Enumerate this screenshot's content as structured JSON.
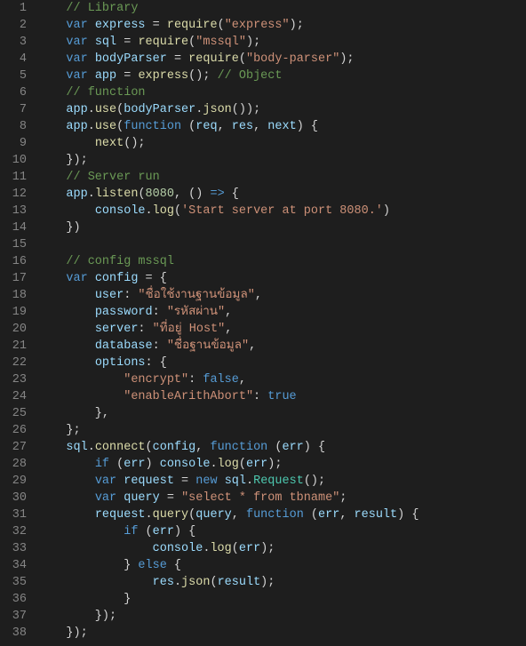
{
  "lines": [
    [
      [
        "c-comment",
        "// Library"
      ]
    ],
    [
      [
        "c-keyword",
        "var"
      ],
      [
        "c-punc",
        " "
      ],
      [
        "c-var",
        "express"
      ],
      [
        "c-punc",
        " = "
      ],
      [
        "c-func",
        "require"
      ],
      [
        "c-punc",
        "("
      ],
      [
        "c-string",
        "\"express\""
      ],
      [
        "c-punc",
        ");"
      ]
    ],
    [
      [
        "c-keyword",
        "var"
      ],
      [
        "c-punc",
        " "
      ],
      [
        "c-var",
        "sql"
      ],
      [
        "c-punc",
        " = "
      ],
      [
        "c-func",
        "require"
      ],
      [
        "c-punc",
        "("
      ],
      [
        "c-string",
        "\"mssql\""
      ],
      [
        "c-punc",
        ");"
      ]
    ],
    [
      [
        "c-keyword",
        "var"
      ],
      [
        "c-punc",
        " "
      ],
      [
        "c-var",
        "bodyParser"
      ],
      [
        "c-punc",
        " = "
      ],
      [
        "c-func",
        "require"
      ],
      [
        "c-punc",
        "("
      ],
      [
        "c-string",
        "\"body-parser\""
      ],
      [
        "c-punc",
        ");"
      ]
    ],
    [
      [
        "c-keyword",
        "var"
      ],
      [
        "c-punc",
        " "
      ],
      [
        "c-var",
        "app"
      ],
      [
        "c-punc",
        " = "
      ],
      [
        "c-func",
        "express"
      ],
      [
        "c-punc",
        "(); "
      ],
      [
        "c-comment",
        "// Object"
      ]
    ],
    [
      [
        "c-comment",
        "// function"
      ]
    ],
    [
      [
        "c-var",
        "app"
      ],
      [
        "c-punc",
        "."
      ],
      [
        "c-func",
        "use"
      ],
      [
        "c-punc",
        "("
      ],
      [
        "c-var",
        "bodyParser"
      ],
      [
        "c-punc",
        "."
      ],
      [
        "c-func",
        "json"
      ],
      [
        "c-punc",
        "());"
      ]
    ],
    [
      [
        "c-var",
        "app"
      ],
      [
        "c-punc",
        "."
      ],
      [
        "c-func",
        "use"
      ],
      [
        "c-punc",
        "("
      ],
      [
        "c-keyword",
        "function"
      ],
      [
        "c-punc",
        " ("
      ],
      [
        "c-param",
        "req"
      ],
      [
        "c-punc",
        ", "
      ],
      [
        "c-param",
        "res"
      ],
      [
        "c-punc",
        ", "
      ],
      [
        "c-param",
        "next"
      ],
      [
        "c-punc",
        ") {"
      ]
    ],
    [
      [
        "c-punc",
        "    "
      ],
      [
        "c-func",
        "next"
      ],
      [
        "c-punc",
        "();"
      ]
    ],
    [
      [
        "c-punc",
        "});"
      ]
    ],
    [
      [
        "c-comment",
        "// Server run"
      ]
    ],
    [
      [
        "c-var",
        "app"
      ],
      [
        "c-punc",
        "."
      ],
      [
        "c-func",
        "listen"
      ],
      [
        "c-punc",
        "("
      ],
      [
        "c-number",
        "8080"
      ],
      [
        "c-punc",
        ", () "
      ],
      [
        "c-keyword",
        "=>"
      ],
      [
        "c-punc",
        " {"
      ]
    ],
    [
      [
        "c-punc",
        "    "
      ],
      [
        "c-var",
        "console"
      ],
      [
        "c-punc",
        "."
      ],
      [
        "c-func",
        "log"
      ],
      [
        "c-punc",
        "("
      ],
      [
        "c-string",
        "'Start server at port 8080.'"
      ],
      [
        "c-punc",
        ")"
      ]
    ],
    [
      [
        "c-punc",
        "})"
      ]
    ],
    [
      [
        "c-punc",
        ""
      ]
    ],
    [
      [
        "c-comment",
        "// config mssql"
      ]
    ],
    [
      [
        "c-keyword",
        "var"
      ],
      [
        "c-punc",
        " "
      ],
      [
        "c-var",
        "config"
      ],
      [
        "c-punc",
        " = {"
      ]
    ],
    [
      [
        "c-punc",
        "    "
      ],
      [
        "c-var",
        "user"
      ],
      [
        "c-punc",
        ": "
      ],
      [
        "c-string",
        "\"ชื่อใช้งานฐานข้อมูล\""
      ],
      [
        "c-punc",
        ","
      ]
    ],
    [
      [
        "c-punc",
        "    "
      ],
      [
        "c-var",
        "password"
      ],
      [
        "c-punc",
        ": "
      ],
      [
        "c-string",
        "\"รหัสผ่าน\""
      ],
      [
        "c-punc",
        ","
      ]
    ],
    [
      [
        "c-punc",
        "    "
      ],
      [
        "c-var",
        "server"
      ],
      [
        "c-punc",
        ": "
      ],
      [
        "c-string",
        "\"ที่อยู่ Host\""
      ],
      [
        "c-punc",
        ","
      ]
    ],
    [
      [
        "c-punc",
        "    "
      ],
      [
        "c-var",
        "database"
      ],
      [
        "c-punc",
        ": "
      ],
      [
        "c-string",
        "\"ชื่อฐานข้อมูล\""
      ],
      [
        "c-punc",
        ","
      ]
    ],
    [
      [
        "c-punc",
        "    "
      ],
      [
        "c-var",
        "options"
      ],
      [
        "c-punc",
        ": {"
      ]
    ],
    [
      [
        "c-punc",
        "        "
      ],
      [
        "c-string",
        "\"encrypt\""
      ],
      [
        "c-punc",
        ": "
      ],
      [
        "c-const",
        "false"
      ],
      [
        "c-punc",
        ","
      ]
    ],
    [
      [
        "c-punc",
        "        "
      ],
      [
        "c-string",
        "\"enableArithAbort\""
      ],
      [
        "c-punc",
        ": "
      ],
      [
        "c-const",
        "true"
      ]
    ],
    [
      [
        "c-punc",
        "    },"
      ]
    ],
    [
      [
        "c-punc",
        "};"
      ]
    ],
    [
      [
        "c-var",
        "sql"
      ],
      [
        "c-punc",
        "."
      ],
      [
        "c-func",
        "connect"
      ],
      [
        "c-punc",
        "("
      ],
      [
        "c-var",
        "config"
      ],
      [
        "c-punc",
        ", "
      ],
      [
        "c-keyword",
        "function"
      ],
      [
        "c-punc",
        " ("
      ],
      [
        "c-param",
        "err"
      ],
      [
        "c-punc",
        ") {"
      ]
    ],
    [
      [
        "c-punc",
        "    "
      ],
      [
        "c-keyword",
        "if"
      ],
      [
        "c-punc",
        " ("
      ],
      [
        "c-var",
        "err"
      ],
      [
        "c-punc",
        ") "
      ],
      [
        "c-var",
        "console"
      ],
      [
        "c-punc",
        "."
      ],
      [
        "c-func",
        "log"
      ],
      [
        "c-punc",
        "("
      ],
      [
        "c-var",
        "err"
      ],
      [
        "c-punc",
        ");"
      ]
    ],
    [
      [
        "c-punc",
        "    "
      ],
      [
        "c-keyword",
        "var"
      ],
      [
        "c-punc",
        " "
      ],
      [
        "c-var",
        "request"
      ],
      [
        "c-punc",
        " = "
      ],
      [
        "c-keyword",
        "new"
      ],
      [
        "c-punc",
        " "
      ],
      [
        "c-var",
        "sql"
      ],
      [
        "c-punc",
        "."
      ],
      [
        "c-type",
        "Request"
      ],
      [
        "c-punc",
        "();"
      ]
    ],
    [
      [
        "c-punc",
        "    "
      ],
      [
        "c-keyword",
        "var"
      ],
      [
        "c-punc",
        " "
      ],
      [
        "c-var",
        "query"
      ],
      [
        "c-punc",
        " = "
      ],
      [
        "c-string",
        "\"select * from tbname\""
      ],
      [
        "c-punc",
        ";"
      ]
    ],
    [
      [
        "c-punc",
        "    "
      ],
      [
        "c-var",
        "request"
      ],
      [
        "c-punc",
        "."
      ],
      [
        "c-func",
        "query"
      ],
      [
        "c-punc",
        "("
      ],
      [
        "c-var",
        "query"
      ],
      [
        "c-punc",
        ", "
      ],
      [
        "c-keyword",
        "function"
      ],
      [
        "c-punc",
        " ("
      ],
      [
        "c-param",
        "err"
      ],
      [
        "c-punc",
        ", "
      ],
      [
        "c-param",
        "result"
      ],
      [
        "c-punc",
        ") {"
      ]
    ],
    [
      [
        "c-punc",
        "        "
      ],
      [
        "c-keyword",
        "if"
      ],
      [
        "c-punc",
        " ("
      ],
      [
        "c-var",
        "err"
      ],
      [
        "c-punc",
        ") {"
      ]
    ],
    [
      [
        "c-punc",
        "            "
      ],
      [
        "c-var",
        "console"
      ],
      [
        "c-punc",
        "."
      ],
      [
        "c-func",
        "log"
      ],
      [
        "c-punc",
        "("
      ],
      [
        "c-var",
        "err"
      ],
      [
        "c-punc",
        ");"
      ]
    ],
    [
      [
        "c-punc",
        "        } "
      ],
      [
        "c-keyword",
        "else"
      ],
      [
        "c-punc",
        " {"
      ]
    ],
    [
      [
        "c-punc",
        "            "
      ],
      [
        "c-var",
        "res"
      ],
      [
        "c-punc",
        "."
      ],
      [
        "c-func",
        "json"
      ],
      [
        "c-punc",
        "("
      ],
      [
        "c-var",
        "result"
      ],
      [
        "c-punc",
        ");"
      ]
    ],
    [
      [
        "c-punc",
        "        }"
      ]
    ],
    [
      [
        "c-punc",
        "    });"
      ]
    ],
    [
      [
        "c-punc",
        "});"
      ]
    ]
  ],
  "indent": "    "
}
